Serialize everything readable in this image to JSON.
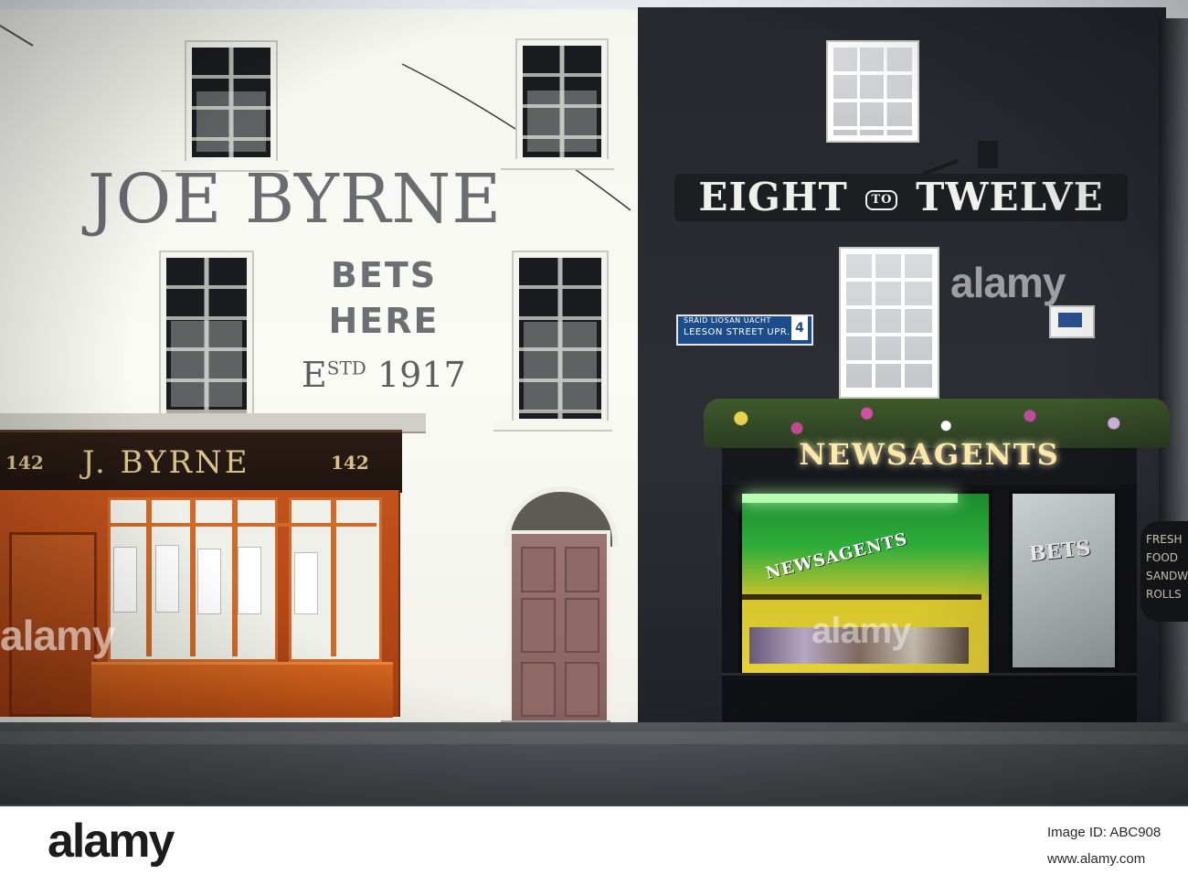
{
  "left_building": {
    "title": "JOE BYRNE",
    "subtitle_line1": "BETS",
    "subtitle_line2": "HERE",
    "estd_prefix": "E",
    "estd_sup": "STD",
    "estd_year": "1917",
    "fascia": "J. BYRNE",
    "fascia_number_left": "142",
    "fascia_number_right": "142"
  },
  "right_building": {
    "sign_left": "EIGHT",
    "sign_badge": "TO",
    "sign_right": "TWELVE",
    "street_sign_irish": "SRÁID LIOSAN UACHT",
    "street_sign_english": "LEESON STREET UPR.",
    "street_sign_number": "4",
    "fascia": "NEWSAGENTS",
    "window_arch_text": "NEWSAGENTS",
    "side_window_text": "BETS",
    "chalkboard": "FRESH\nFOOD\nSANDWICH\nROLLS"
  },
  "watermark": {
    "text": "alamy"
  },
  "footer": {
    "logo": "alamy",
    "image_id": "Image ID: ABC908",
    "site": "www.alamy.com"
  },
  "colors": {
    "left_wall": "#f6f6f1",
    "right_wall": "#26282e",
    "shopfront_orange": "#c2531c",
    "fascia_gold": "#d8c48a",
    "news_glow": "#ffe9a8",
    "street_sign_blue": "#1c4d8a"
  }
}
